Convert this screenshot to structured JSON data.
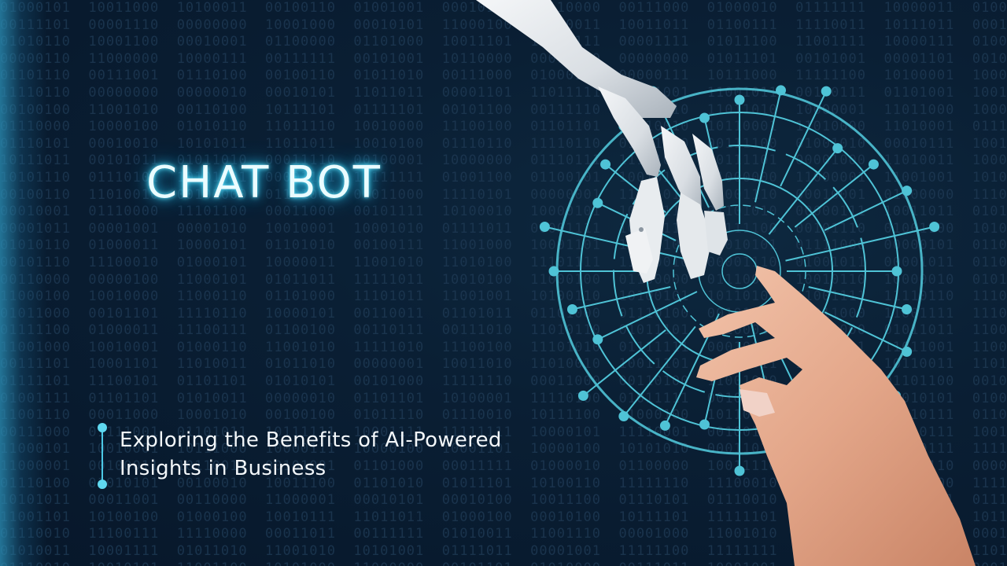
{
  "slide": {
    "title": "CHAT BOT",
    "subtitle_line_1": "Exploring the Benefits of AI-Powered",
    "subtitle_line_2": "Insights in Business"
  },
  "colors": {
    "background": "#07182b",
    "accent": "#4cc9e6",
    "title_glow": "#2bc7f2",
    "circuit": "#4fc3d6"
  },
  "graphics": {
    "background_pattern": "binary-code-pattern",
    "robot_hand": "robot-hand-image",
    "human_hand": "human-hand-image",
    "circuit": "circuit-ring-graphic"
  }
}
